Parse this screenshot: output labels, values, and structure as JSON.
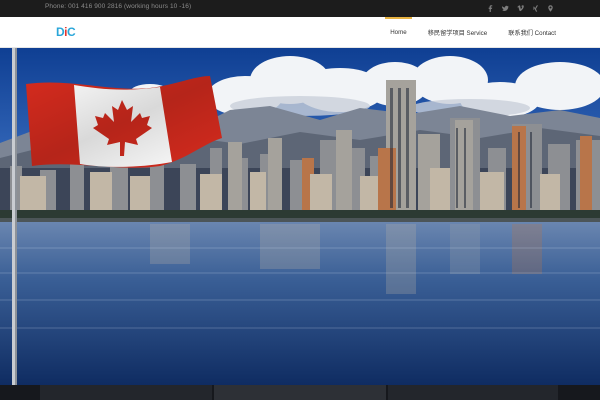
{
  "topbar": {
    "phone_text": "Phone: 001 416 900 2816 (working hours 10 -16)",
    "social_icons": [
      "facebook-icon",
      "twitter-icon",
      "vimeo-icon",
      "xing-icon",
      "location-pin-icon"
    ]
  },
  "header": {
    "logo": {
      "part1": "D",
      "part2": "i",
      "part3": "C"
    },
    "nav": [
      {
        "label": "Home",
        "active": true
      },
      {
        "label": "移民留学项目 Service",
        "active": false
      },
      {
        "label": "联系我们 Contact",
        "active": false
      }
    ]
  },
  "hero": {
    "image": "canadian-flag-over-vancouver-skyline"
  },
  "colors": {
    "topbar_bg": "#1c1c1c",
    "header_bg": "#ffffff",
    "nav_active_accent": "#e7b342",
    "logo_blue": "#2aa6d9",
    "logo_red": "#e8332a",
    "flag_red": "#d52b1e"
  }
}
